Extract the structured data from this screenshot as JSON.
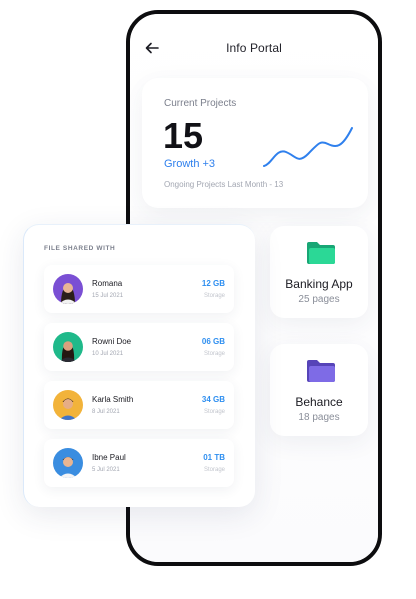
{
  "header": {
    "title": "Info Portal",
    "back_icon": "arrow-left-icon"
  },
  "projects": {
    "label": "Current Projects",
    "count": "15",
    "growth": "Growth +3",
    "note": "Ongoing Projects Last Month - 13",
    "accent": "#2f80ed",
    "trend_icon": "sparkline-trend"
  },
  "folders": [
    {
      "name": "Banking App",
      "pages": "25 pages",
      "color": "#1fc58a",
      "icon": "folder-icon"
    },
    {
      "name": "Behance",
      "pages": "18 pages",
      "color": "#6f5bd8",
      "icon": "folder-icon"
    }
  ],
  "shared": {
    "title": "FILE SHARED WITH",
    "people": [
      {
        "name": "Romana",
        "date": "15 Jul 2021",
        "size": "12 GB",
        "size_label": "Storage",
        "avatar_color": "#7a4fd4"
      },
      {
        "name": "Rowni Doe",
        "date": "10 Jul 2021",
        "size": "06 GB",
        "size_label": "Storage",
        "avatar_color": "#1fb98a"
      },
      {
        "name": "Karla Smith",
        "date": "8 Jul 2021",
        "size": "34 GB",
        "size_label": "Storage",
        "avatar_color": "#f2b33a"
      },
      {
        "name": "Ibne Paul",
        "date": "5 Jul 2021",
        "size": "01 TB",
        "size_label": "Storage",
        "avatar_color": "#3a8de0"
      }
    ]
  }
}
